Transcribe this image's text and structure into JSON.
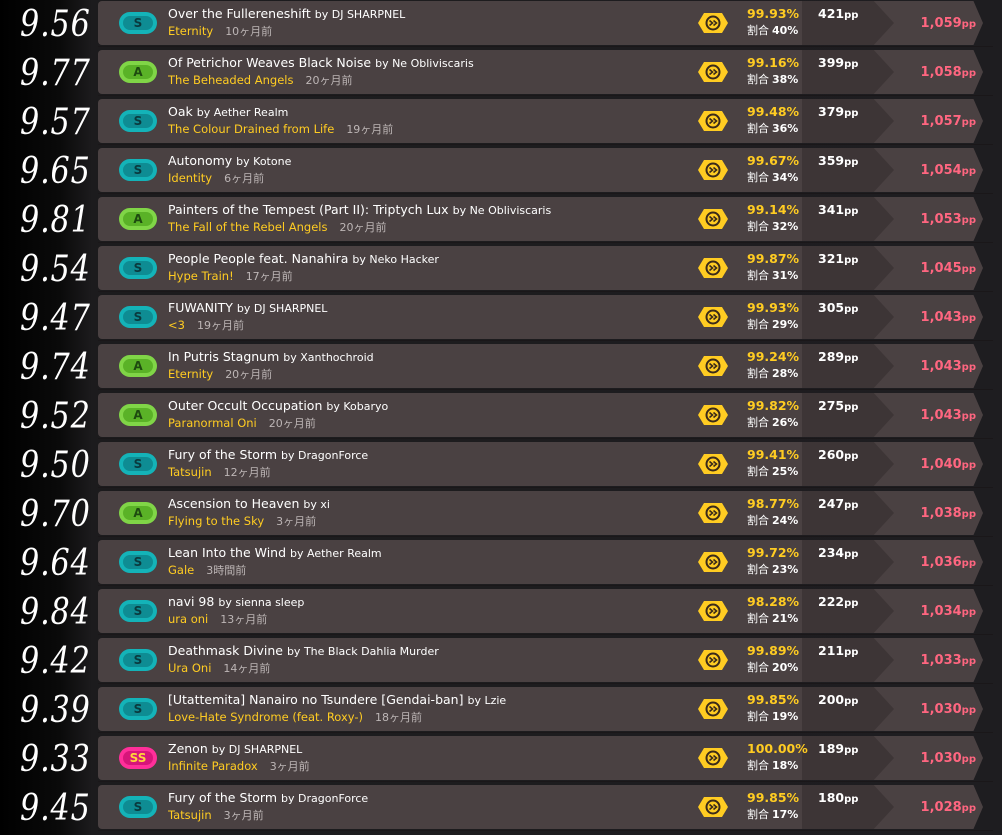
{
  "pp_unit": "pp",
  "weight_label": "割合",
  "colors": {
    "grade_S": "#14b3b8",
    "grade_A": "#80d547",
    "grade_SS": "#ff2f9a",
    "difficulty_text": "#ffcc22",
    "accuracy_text": "#ffcc22",
    "weighted_pp_text": "#ff6680",
    "card_bg": "#4a4142"
  },
  "mod_icon": "double-time-mod-icon",
  "scores": [
    {
      "handwritten": "9.56",
      "grade": "S",
      "title": "Over the Fullereneshift",
      "by": "by DJ SHARPNEL",
      "difficulty": "Eternity",
      "ago": "10ヶ月前",
      "accuracy": "99.93%",
      "weight": "40%",
      "pp": "421",
      "weighted_pp": "1,059"
    },
    {
      "handwritten": "9.77",
      "grade": "A",
      "title": "Of Petrichor Weaves Black Noise",
      "by": "by Ne Obliviscaris",
      "difficulty": "The Beheaded Angels",
      "ago": "20ヶ月前",
      "accuracy": "99.16%",
      "weight": "38%",
      "pp": "399",
      "weighted_pp": "1,058"
    },
    {
      "handwritten": "9.57",
      "grade": "S",
      "title": "Oak",
      "by": "by Aether Realm",
      "difficulty": "The Colour Drained from Life",
      "ago": "19ヶ月前",
      "accuracy": "99.48%",
      "weight": "36%",
      "pp": "379",
      "weighted_pp": "1,057"
    },
    {
      "handwritten": "9.65",
      "grade": "S",
      "title": "Autonomy",
      "by": "by Kotone",
      "difficulty": "Identity",
      "ago": "6ヶ月前",
      "accuracy": "99.67%",
      "weight": "34%",
      "pp": "359",
      "weighted_pp": "1,054"
    },
    {
      "handwritten": "9.81",
      "grade": "A",
      "title": "Painters of the Tempest (Part II): Triptych Lux",
      "by": "by Ne Obliviscaris",
      "difficulty": "The Fall of the Rebel Angels",
      "ago": "20ヶ月前",
      "accuracy": "99.14%",
      "weight": "32%",
      "pp": "341",
      "weighted_pp": "1,053"
    },
    {
      "handwritten": "9.54",
      "grade": "S",
      "title": "People People feat. Nanahira",
      "by": "by Neko Hacker",
      "difficulty": "Hype Train!",
      "ago": "17ヶ月前",
      "accuracy": "99.87%",
      "weight": "31%",
      "pp": "321",
      "weighted_pp": "1,045"
    },
    {
      "handwritten": "9.47",
      "grade": "S",
      "title": "FUWANITY",
      "by": "by DJ SHARPNEL",
      "difficulty": "<3",
      "ago": "19ヶ月前",
      "accuracy": "99.93%",
      "weight": "29%",
      "pp": "305",
      "weighted_pp": "1,043"
    },
    {
      "handwritten": "9.74",
      "grade": "A",
      "title": "In Putris Stagnum",
      "by": "by Xanthochroid",
      "difficulty": "Eternity",
      "ago": "20ヶ月前",
      "accuracy": "99.24%",
      "weight": "28%",
      "pp": "289",
      "weighted_pp": "1,043"
    },
    {
      "handwritten": "9.52",
      "grade": "A",
      "title": "Outer Occult Occupation",
      "by": "by Kobaryo",
      "difficulty": "Paranormal Oni",
      "ago": "20ヶ月前",
      "accuracy": "99.82%",
      "weight": "26%",
      "pp": "275",
      "weighted_pp": "1,043"
    },
    {
      "handwritten": "9.50",
      "grade": "S",
      "title": "Fury of the Storm",
      "by": "by DragonForce",
      "difficulty": "Tatsujin",
      "ago": "12ヶ月前",
      "accuracy": "99.41%",
      "weight": "25%",
      "pp": "260",
      "weighted_pp": "1,040"
    },
    {
      "handwritten": "9.70",
      "grade": "A",
      "title": "Ascension to Heaven",
      "by": "by xi",
      "difficulty": "Flying to the Sky",
      "ago": "3ヶ月前",
      "accuracy": "98.77%",
      "weight": "24%",
      "pp": "247",
      "weighted_pp": "1,038"
    },
    {
      "handwritten": "9.64",
      "grade": "S",
      "title": "Lean Into the Wind",
      "by": "by Aether Realm",
      "difficulty": "Gale",
      "ago": "3時間前",
      "accuracy": "99.72%",
      "weight": "23%",
      "pp": "234",
      "weighted_pp": "1,036"
    },
    {
      "handwritten": "9.84",
      "grade": "S",
      "title": "navi 98",
      "by": "by sienna sleep",
      "difficulty": "ura oni",
      "ago": "13ヶ月前",
      "accuracy": "98.28%",
      "weight": "21%",
      "pp": "222",
      "weighted_pp": "1,034"
    },
    {
      "handwritten": "9.42",
      "grade": "S",
      "title": "Deathmask Divine",
      "by": "by The Black Dahlia Murder",
      "difficulty": "Ura Oni",
      "ago": "14ヶ月前",
      "accuracy": "99.89%",
      "weight": "20%",
      "pp": "211",
      "weighted_pp": "1,033"
    },
    {
      "handwritten": "9.39",
      "grade": "S",
      "title": "[Utattemita] Nanairo no Tsundere [Gendai-ban]",
      "by": "by Lzie",
      "difficulty": "Love-Hate Syndrome (feat. Roxy-)",
      "ago": "18ヶ月前",
      "accuracy": "99.85%",
      "weight": "19%",
      "pp": "200",
      "weighted_pp": "1,030"
    },
    {
      "handwritten": "9.33",
      "grade": "SS",
      "title": "Zenon",
      "by": "by DJ SHARPNEL",
      "difficulty": "Infinite Paradox",
      "ago": "3ヶ月前",
      "accuracy": "100.00%",
      "weight": "18%",
      "pp": "189",
      "weighted_pp": "1,030"
    },
    {
      "handwritten": "9.45",
      "grade": "S",
      "title": "Fury of the Storm",
      "by": "by DragonForce",
      "difficulty": "Tatsujin",
      "ago": "3ヶ月前",
      "accuracy": "99.85%",
      "weight": "17%",
      "pp": "180",
      "weighted_pp": "1,028"
    }
  ]
}
